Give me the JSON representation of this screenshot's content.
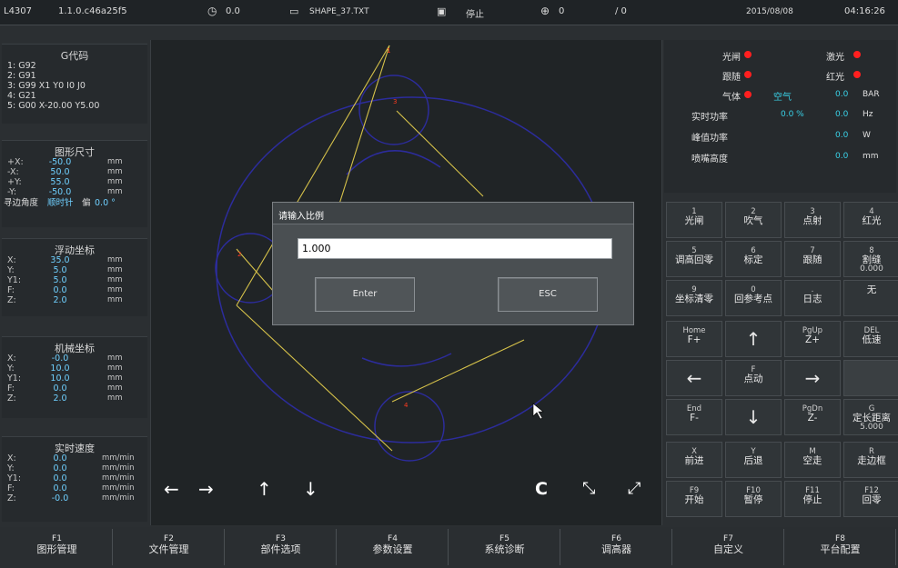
{
  "topbar": {
    "machine": "L4307",
    "version": "1.1.0.c46a25f5",
    "speed": "0.0",
    "file": "SHAPE_37.TXT",
    "state": "停止",
    "count": "0",
    "count_total": "/ 0",
    "date": "2015/08/08",
    "time": "04:16:26"
  },
  "gcode": {
    "title": "G代码",
    "lines": [
      "1: G92",
      "2: G91",
      "3: G99 X1 Y0 I0 J0",
      "4: G21",
      "5: G00 X-20.00 Y5.00"
    ]
  },
  "shape_size": {
    "title": "图形尺寸",
    "rows": [
      {
        "label": "+X:",
        "value": "-50.0",
        "unit": "mm"
      },
      {
        "label": "-X:",
        "value": "50.0",
        "unit": "mm"
      },
      {
        "label": "+Y:",
        "value": "55.0",
        "unit": "mm"
      },
      {
        "label": "-Y:",
        "value": "-50.0",
        "unit": "mm"
      }
    ],
    "edge_label": "寻边角度",
    "edge_dir": "顺时针",
    "edge_suffix": "偏",
    "edge_value": "0.0 °"
  },
  "float_coord": {
    "title": "浮动坐标",
    "rows": [
      {
        "label": "X:",
        "value": "35.0",
        "unit": "mm"
      },
      {
        "label": "Y:",
        "value": "5.0",
        "unit": "mm"
      },
      {
        "label": "Y1:",
        "value": "5.0",
        "unit": "mm"
      },
      {
        "label": "F:",
        "value": "0.0",
        "unit": "mm"
      },
      {
        "label": "Z:",
        "value": "2.0",
        "unit": "mm"
      }
    ]
  },
  "machine_coord": {
    "title": "机械坐标",
    "rows": [
      {
        "label": "X:",
        "value": "-0.0",
        "unit": "mm"
      },
      {
        "label": "Y:",
        "value": "10.0",
        "unit": "mm"
      },
      {
        "label": "Y1:",
        "value": "10.0",
        "unit": "mm"
      },
      {
        "label": "F:",
        "value": "0.0",
        "unit": "mm"
      },
      {
        "label": "Z:",
        "value": "2.0",
        "unit": "mm"
      }
    ]
  },
  "speed": {
    "title": "实时速度",
    "rows": [
      {
        "label": "X:",
        "value": "0.0",
        "unit": "mm/min"
      },
      {
        "label": "Y:",
        "value": "0.0",
        "unit": "mm/min"
      },
      {
        "label": "Y1:",
        "value": "0.0",
        "unit": "mm/min"
      },
      {
        "label": "F:",
        "value": "0.0",
        "unit": "mm/min"
      },
      {
        "label": "Z:",
        "value": "-0.0",
        "unit": "mm/min"
      }
    ]
  },
  "dialog": {
    "title": "请输入比例",
    "value": "1.000",
    "enter": "Enter",
    "esc": "ESC"
  },
  "status": {
    "shutter": "光闸",
    "laser": "激光",
    "follow": "跟随",
    "red_light": "红光",
    "gas": "气体",
    "air": "空气",
    "gas_value": "0.0",
    "gas_unit": "BAR",
    "power_label": "实时功率",
    "power_value": "0.0 %",
    "freq_value": "0.0",
    "freq_unit": "Hz",
    "peak_label": "峰值功率",
    "peak_value": "0.0",
    "peak_unit": "W",
    "nozzle_label": "喷嘴高度",
    "nozzle_value": "0.0",
    "nozzle_unit": "mm",
    "dot_color": "#ff1f1f"
  },
  "keys": [
    {
      "k1": "1",
      "k2": "光闸",
      "k3": ""
    },
    {
      "k1": "2",
      "k2": "吹气",
      "k3": ""
    },
    {
      "k1": "3",
      "k2": "点射",
      "k3": ""
    },
    {
      "k1": "4",
      "k2": "红光",
      "k3": ""
    },
    {
      "k1": "5",
      "k2": "调高回零",
      "k3": ""
    },
    {
      "k1": "6",
      "k2": "标定",
      "k3": ""
    },
    {
      "k1": "7",
      "k2": "跟随",
      "k3": ""
    },
    {
      "k1": "8",
      "k2": "割缝",
      "k3": "0.000"
    },
    {
      "k1": "9",
      "k2": "坐标清零",
      "k3": ""
    },
    {
      "k1": "0",
      "k2": "回参考点",
      "k3": ""
    },
    {
      "k1": ".",
      "k2": "日志",
      "k3": ""
    },
    {
      "k1": "",
      "k2": "无",
      "k3": ""
    },
    {
      "k1": "Home",
      "k2": "F+",
      "k3": ""
    },
    {
      "k1": "",
      "k2": "↑",
      "k3": ""
    },
    {
      "k1": "PgUp",
      "k2": "Z+",
      "k3": ""
    },
    {
      "k1": "DEL",
      "k2": "低速",
      "k3": ""
    },
    {
      "k1": "",
      "k2": "←",
      "k3": ""
    },
    {
      "k1": "F",
      "k2": "点动",
      "k3": ""
    },
    {
      "k1": "",
      "k2": "→",
      "k3": ""
    },
    {
      "k1": "",
      "k2": "",
      "k3": ""
    },
    {
      "k1": "End",
      "k2": "F-",
      "k3": ""
    },
    {
      "k1": "",
      "k2": "↓",
      "k3": ""
    },
    {
      "k1": "PgDn",
      "k2": "Z-",
      "k3": ""
    },
    {
      "k1": "G",
      "k2": "定长距离",
      "k3": "5.000"
    },
    {
      "k1": "X",
      "k2": "前进",
      "k3": ""
    },
    {
      "k1": "Y",
      "k2": "后退",
      "k3": ""
    },
    {
      "k1": "M",
      "k2": "空走",
      "k3": ""
    },
    {
      "k1": "R",
      "k2": "走边框",
      "k3": ""
    },
    {
      "k1": "F9",
      "k2": "开始",
      "k3": ""
    },
    {
      "k1": "F10",
      "k2": "暂停",
      "k3": ""
    },
    {
      "k1": "F11",
      "k2": "停止",
      "k3": ""
    },
    {
      "k1": "F12",
      "k2": "回零",
      "k3": ""
    }
  ],
  "toolbar": {
    "left": "←",
    "right": "→",
    "up": "↑",
    "down": "↓",
    "rotate": "C",
    "shrink": "⤡",
    "expand": "⤢"
  },
  "fkeys": [
    {
      "key": "F1",
      "label": "图形管理"
    },
    {
      "key": "F2",
      "label": "文件管理"
    },
    {
      "key": "F3",
      "label": "部件选项"
    },
    {
      "key": "F4",
      "label": "参数设置"
    },
    {
      "key": "F5",
      "label": "系统诊断"
    },
    {
      "key": "F6",
      "label": "调高器"
    },
    {
      "key": "F7",
      "label": "自定义"
    },
    {
      "key": "F8",
      "label": "平台配置"
    }
  ],
  "colors": {
    "shape_outline": "#2c2c9c",
    "path_line": "#d6c24a",
    "start_point": "#ff3b1f",
    "value_text": "#6fd0ff"
  }
}
